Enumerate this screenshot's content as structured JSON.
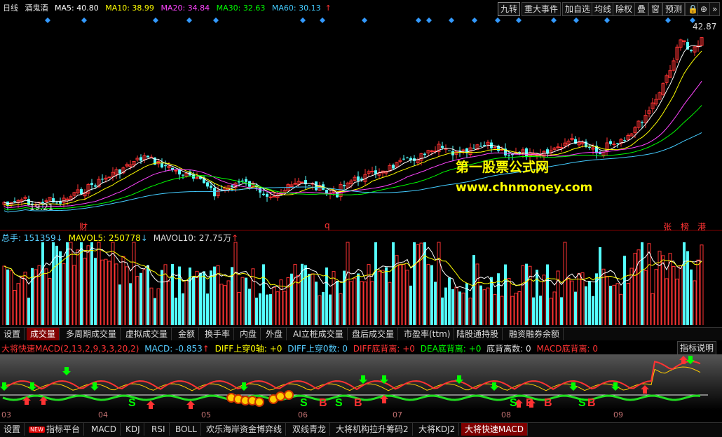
{
  "header": {
    "period": "日线",
    "name": "酒鬼酒",
    "ma": [
      {
        "label": "MA5: 40.80",
        "color": "#ffffff"
      },
      {
        "label": "MA10: 38.99",
        "color": "#ffff00"
      },
      {
        "label": "MA20: 34.84",
        "color": "#ff44ff"
      },
      {
        "label": "MA30: 32.63",
        "color": "#00ff00"
      },
      {
        "label": "MA60: 30.13",
        "color": "#44ccff"
      }
    ]
  },
  "toolbar": {
    "jiuzhuan": "九转",
    "events": "重大事件",
    "add_fav": "加自选",
    "avg": "均线",
    "adjust": "除权",
    "overlay": "叠",
    "window": "窗",
    "warning": "预测"
  },
  "price_panel": {
    "high_label": "42.87",
    "low_label": "19.21",
    "marks": [
      "财",
      "q",
      "张",
      "榜",
      "港"
    ]
  },
  "watermark": {
    "line1": "第一股票公式网",
    "line2": "www.chnmoney.com"
  },
  "volume_panel": {
    "total": "总手: 151359",
    "mavol5": "MAVOL5: 250778",
    "mavol10": "MAVOL10: 27.75万"
  },
  "volume_tabs": [
    "设置",
    "成交量",
    "多周期成交量",
    "虚拟成交量",
    "金额",
    "换手率",
    "内盘",
    "外盘",
    "AI立桩成交量",
    "盘后成交量",
    "市盈率(ttm)",
    "陆股通持股",
    "融资融券余额"
  ],
  "indicator": {
    "title": "大将快速MACD(2,13,2,9,3,3,20,2)",
    "macd": "MACD: -0.853",
    "diff_up_zero": "DIFF上穿0轴: +0",
    "diff_up_zero_count": "DIFF上穿0数: 0",
    "diff_div": "DIFF底背离: +0",
    "dea_div": "DEA底背离: +0",
    "bottom_div_count": "底背离数: 0",
    "macd_div": "MACD底背离: 0",
    "explain": "指标说明"
  },
  "x_axis": [
    "03",
    "04",
    "05",
    "06",
    "07",
    "08",
    "09"
  ],
  "bottom_tabs": [
    "设置",
    "指标平台",
    "MACD",
    "KDJ",
    "RSI",
    "BOLL",
    "欢乐海岸资金博弈线",
    "双线青龙",
    "大将机构拉升筹码2",
    "大将KDJ2",
    "大将快速MACD"
  ],
  "bottom_new_badge": "NEW",
  "colors": {
    "up": "#ff3333",
    "down": "#54ffff",
    "ma5": "#ffffff",
    "ma10": "#ffff00",
    "ma20": "#ff44ff",
    "ma30": "#00ff00",
    "ma60": "#44ccff"
  }
}
